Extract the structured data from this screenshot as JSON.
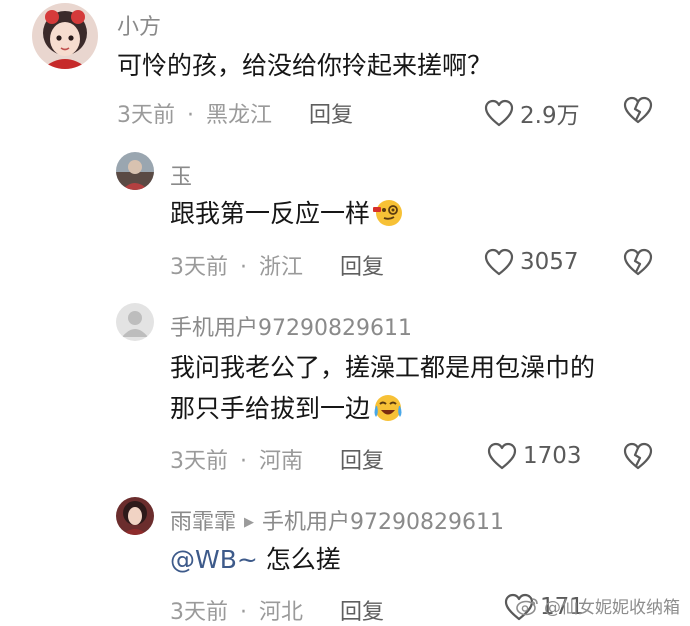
{
  "comments": [
    {
      "username": "小方",
      "text": "可怜的孩，给没给你拎起来搓啊？",
      "time": "3天前",
      "location": "黑龙江",
      "reply_label": "回复",
      "likes": "2.9万",
      "avatar_icon": "girl-portrait-avatar"
    },
    {
      "username": "玉",
      "text": "跟我第一反应一样",
      "emoji": "face-with-monocle-emoji",
      "time": "3天前",
      "location": "浙江",
      "reply_label": "回复",
      "likes": "3057",
      "avatar_icon": "photo-avatar"
    },
    {
      "username": "手机用户97290829611",
      "text_line1": "我问我老公了，搓澡工都是用包澡巾的",
      "text_line2": "那只手给拔到一边",
      "emoji": "crying-laughing-emoji",
      "time": "3天前",
      "location": "河南",
      "reply_label": "回复",
      "likes": "1703",
      "avatar_icon": "default-user-avatar"
    },
    {
      "username": "雨霏霏",
      "reply_to": "手机用户97290829611",
      "mention": "@WB~",
      "text": " 怎么搓",
      "time": "3天前",
      "location": "河北",
      "reply_label": "回复",
      "likes": "171",
      "avatar_icon": "woman-portrait-avatar"
    }
  ],
  "separator": "·",
  "watermark": "@仙女妮妮收纳箱",
  "colors": {
    "text": "#161616",
    "muted": "#9a9a9a",
    "mention": "#3d5a8a",
    "icon": "#5a5a5a"
  }
}
